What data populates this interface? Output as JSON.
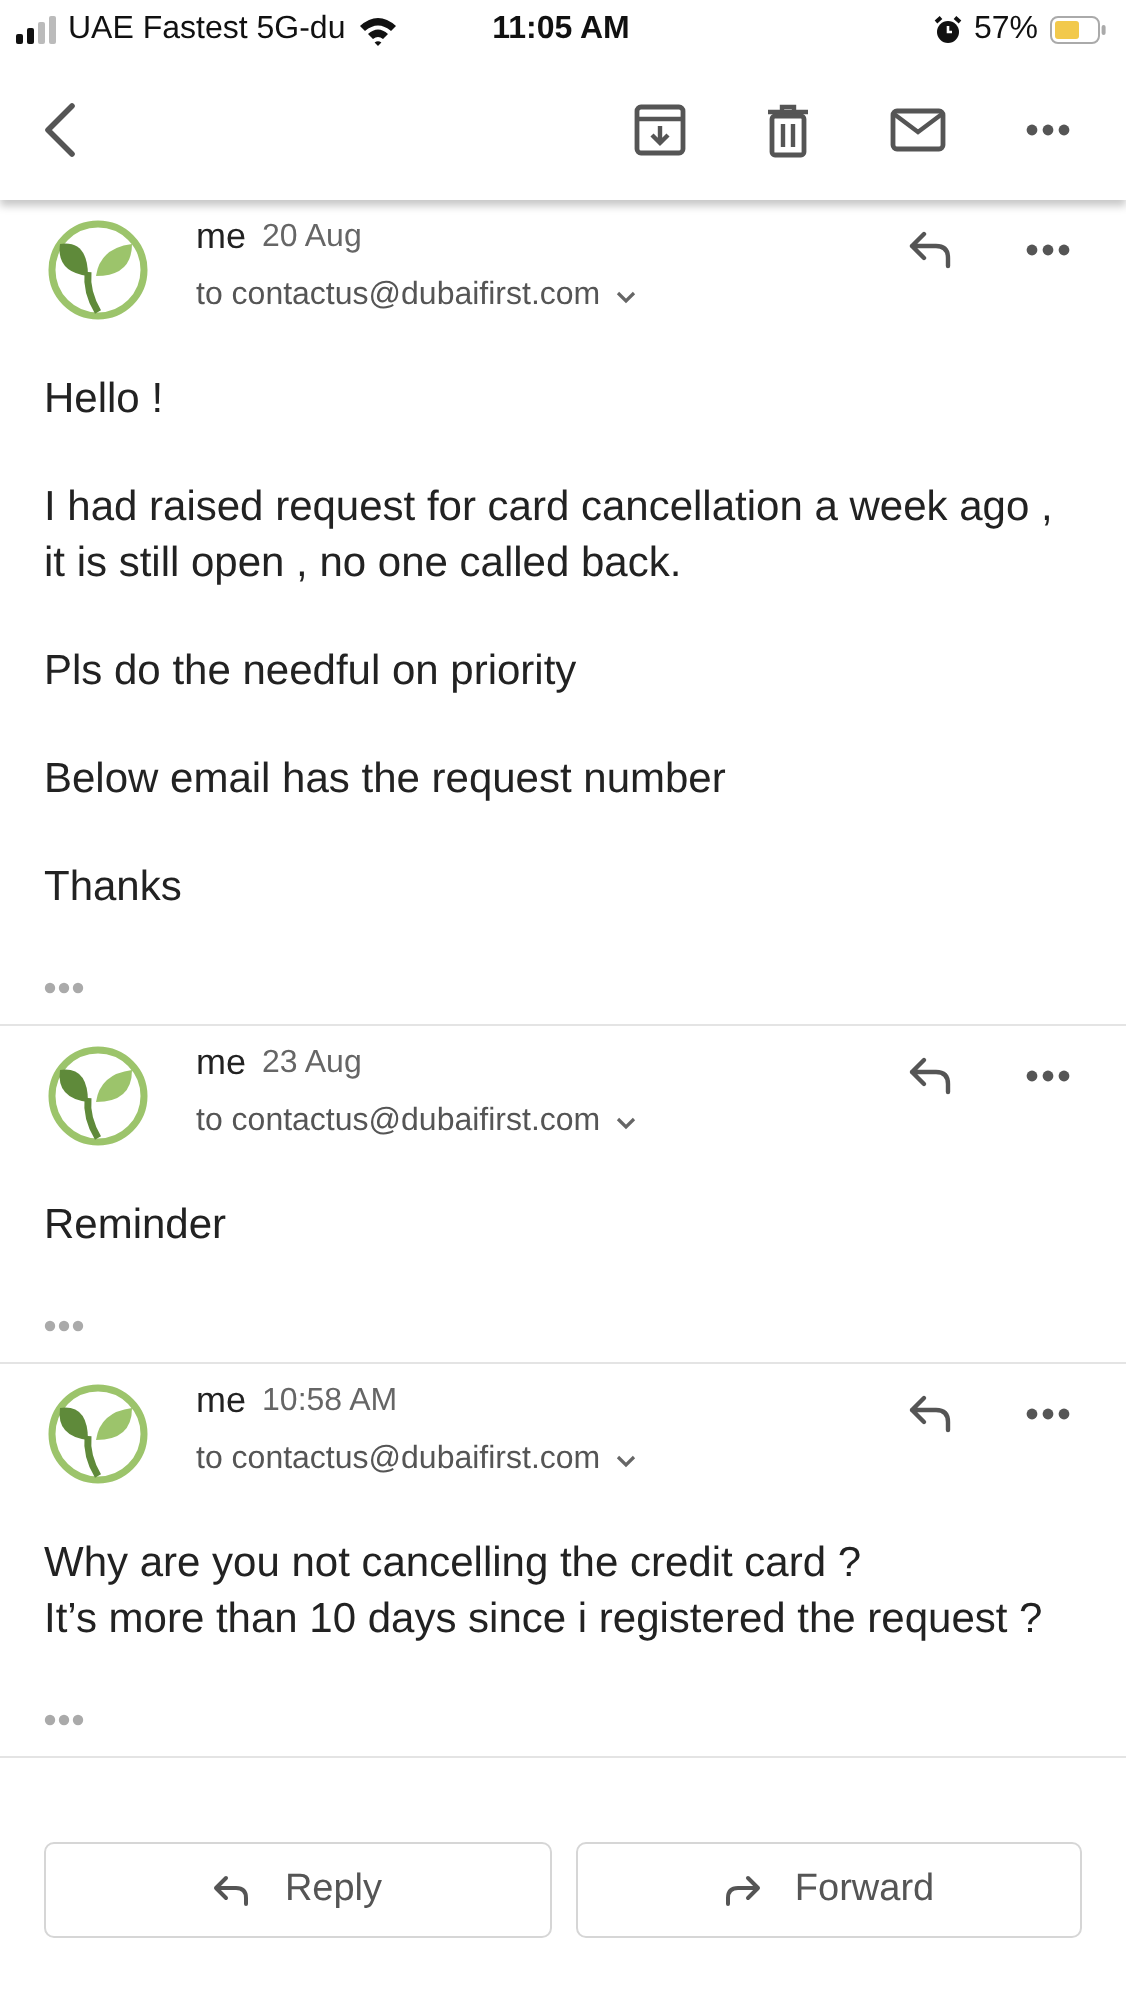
{
  "status_bar": {
    "carrier": "UAE Fastest 5G-du",
    "time": "11:05 AM",
    "battery": "57%"
  },
  "messages": [
    {
      "sender": "me",
      "date": "20 Aug",
      "recipient": "to contactus@dubaifirst.com",
      "body": [
        "Hello !",
        "I had raised request for card cancellation a week ago , it is still open , no one called back.",
        "Pls do the needful on priority",
        "Below email has the request number",
        "Thanks"
      ]
    },
    {
      "sender": "me",
      "date": "23 Aug",
      "recipient": "to contactus@dubaifirst.com",
      "body": [
        "Reminder"
      ]
    },
    {
      "sender": "me",
      "date": "10:58 AM",
      "recipient": "to contactus@dubaifirst.com",
      "body": [
        "Why are you not cancelling the credit card ?\nIt’s more than 10 days since i registered the request ?"
      ]
    }
  ],
  "actions": [
    {
      "kind": "reply",
      "label": "Reply"
    },
    {
      "kind": "forward",
      "label": "Forward"
    }
  ]
}
